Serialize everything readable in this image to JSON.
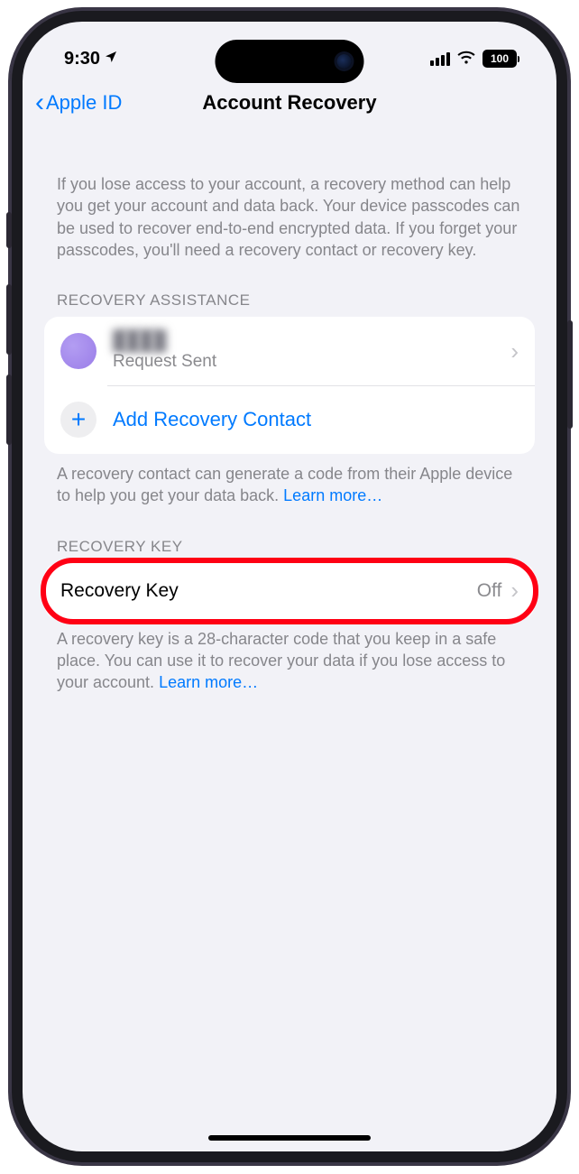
{
  "status": {
    "time": "9:30",
    "battery": "100"
  },
  "nav": {
    "back": "Apple ID",
    "title": "Account Recovery"
  },
  "intro": "If you lose access to your account, a recovery method can help you get your account and data back. Your device passcodes can be used to recover end-to-end encrypted data. If you forget your passcodes, you'll need a recovery contact or recovery key.",
  "sections": {
    "assistance": {
      "header": "RECOVERY ASSISTANCE",
      "contact": {
        "name": "████",
        "status": "Request Sent"
      },
      "add_label": "Add Recovery Contact",
      "footer_text": "A recovery contact can generate a code from their Apple device to help you get your data back. ",
      "footer_link": "Learn more…"
    },
    "key": {
      "header": "RECOVERY KEY",
      "label": "Recovery Key",
      "value": "Off",
      "footer_text": "A recovery key is a 28-character code that you keep in a safe place. You can use it to recover your data if you lose access to your account. ",
      "footer_link": "Learn more…"
    }
  }
}
